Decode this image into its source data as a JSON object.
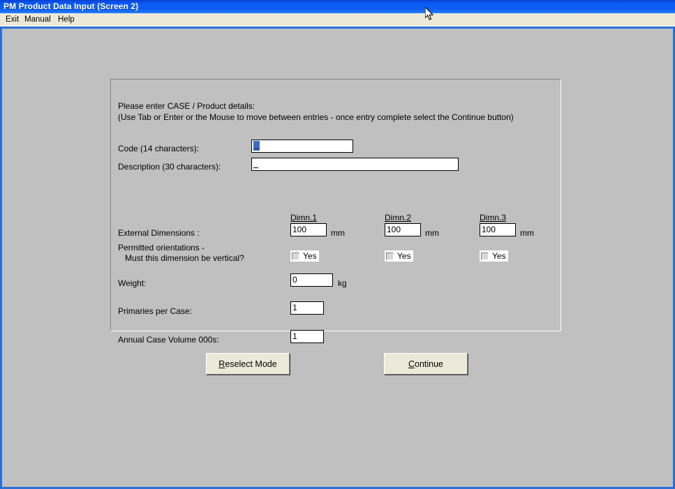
{
  "window": {
    "title": "PM Product Data Input (Screen 2)"
  },
  "menubar": {
    "items": [
      {
        "label": "Exit"
      },
      {
        "label": "Manual"
      },
      {
        "label": "Help"
      }
    ]
  },
  "panel": {
    "instructions": {
      "line1": "Please enter CASE / Product details:",
      "line2": "(Use Tab or Enter or the Mouse to move between entries - once entry complete select the Continue button)"
    },
    "fields": {
      "code": {
        "label": "Code (14 characters):",
        "value": "",
        "selection_char": "_"
      },
      "description": {
        "label": "Description (30 characters):",
        "value": "_"
      },
      "external_dimensions": {
        "label": "External Dimensions :",
        "columns": [
          {
            "header": "Dimn.1",
            "value": "100",
            "unit": "mm"
          },
          {
            "header": "Dimn.2",
            "value": "100",
            "unit": "mm"
          },
          {
            "header": "Dimn.3",
            "value": "100",
            "unit": "mm"
          }
        ]
      },
      "orientations": {
        "label_line1": "Permitted orientations -",
        "label_line2": "Must this dimension be vertical?",
        "checkboxes": [
          {
            "label": "Yes",
            "checked": false
          },
          {
            "label": "Yes",
            "checked": false
          },
          {
            "label": "Yes",
            "checked": false
          }
        ]
      },
      "weight": {
        "label": "Weight:",
        "value": "0",
        "unit": "kg"
      },
      "primaries_per_case": {
        "label": "Primaries per Case:",
        "value": "1"
      },
      "annual_case_volume": {
        "label": "Annual Case Volume 000s:",
        "value": "1"
      }
    }
  },
  "buttons": {
    "reselect": {
      "accel": "R",
      "rest": "eselect Mode"
    },
    "continue": {
      "accel": "C",
      "rest": "ontinue"
    }
  },
  "colors": {
    "title_bar": "#0b5ff8",
    "menu_bar": "#ece9d8",
    "client_bg": "#c0c0c0",
    "button_face": "#ece9d8",
    "selection": "#3a6ec4"
  }
}
